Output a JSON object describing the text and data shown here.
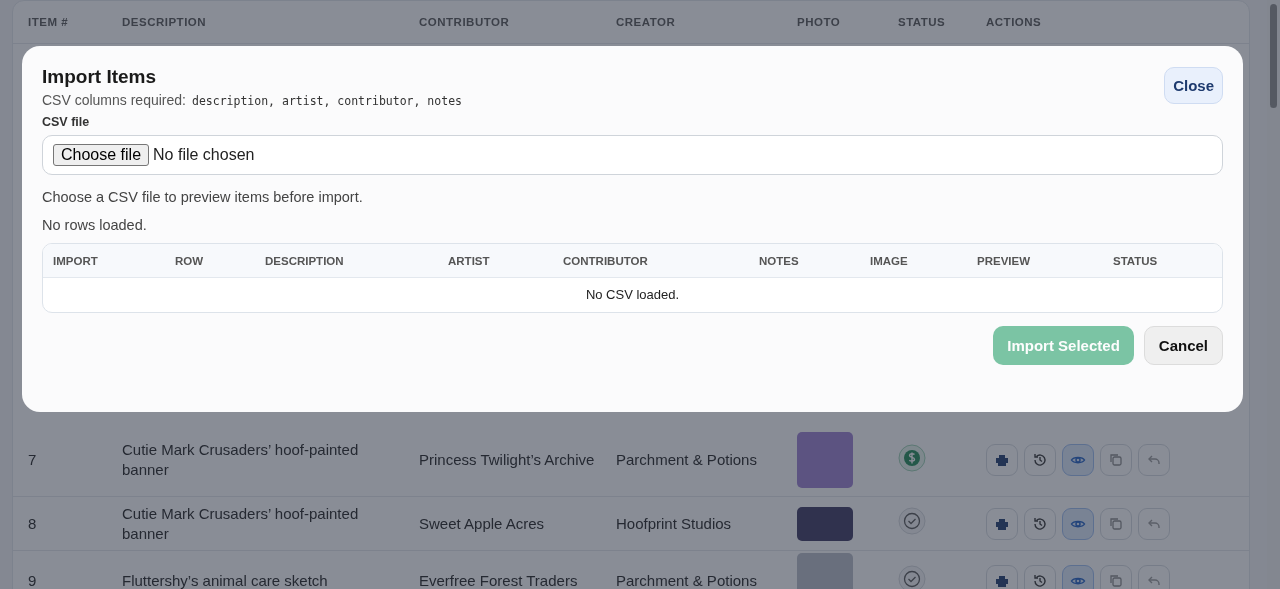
{
  "table": {
    "columns": [
      "ITEM #",
      "DESCRIPTION",
      "CONTRIBUTOR",
      "CREATOR",
      "PHOTO",
      "STATUS",
      "ACTIONS"
    ],
    "rows": [
      {
        "item": "7",
        "description": "Cutie Mark Crusaders’ hoof-painted banner",
        "contributor": "Princess Twilight’s Archive",
        "creator": "Parchment & Potions",
        "kind": "paid"
      },
      {
        "item": "8",
        "description": "Cutie Mark Crusaders’ hoof-painted banner",
        "contributor": "Sweet Apple Acres",
        "creator": "Hoofprint Studios",
        "kind": "done"
      },
      {
        "item": "9",
        "description": "Fluttershy’s animal care sketch",
        "contributor": "Everfree Forest Traders",
        "creator": "Parchment & Potions",
        "kind": "done"
      }
    ]
  },
  "modal": {
    "title": "Import Items",
    "required_label": "CSV columns required:",
    "required_columns": "description, artist, contributor, notes",
    "close": "Close",
    "file_label": "CSV file",
    "file_button": "Choose file",
    "file_status": "No file chosen",
    "hint": "Choose a CSV file to preview items before import.",
    "rows_status": "No rows loaded.",
    "preview_columns": [
      "IMPORT",
      "ROW",
      "DESCRIPTION",
      "ARTIST",
      "CONTRIBUTOR",
      "NOTES",
      "IMAGE",
      "PREVIEW",
      "STATUS"
    ],
    "empty": "No CSV loaded.",
    "buttons": [
      {
        "label": "Import Selected",
        "kind": "primary",
        "disabled": true
      },
      {
        "label": "Cancel",
        "kind": "secondary",
        "disabled": false
      }
    ]
  }
}
